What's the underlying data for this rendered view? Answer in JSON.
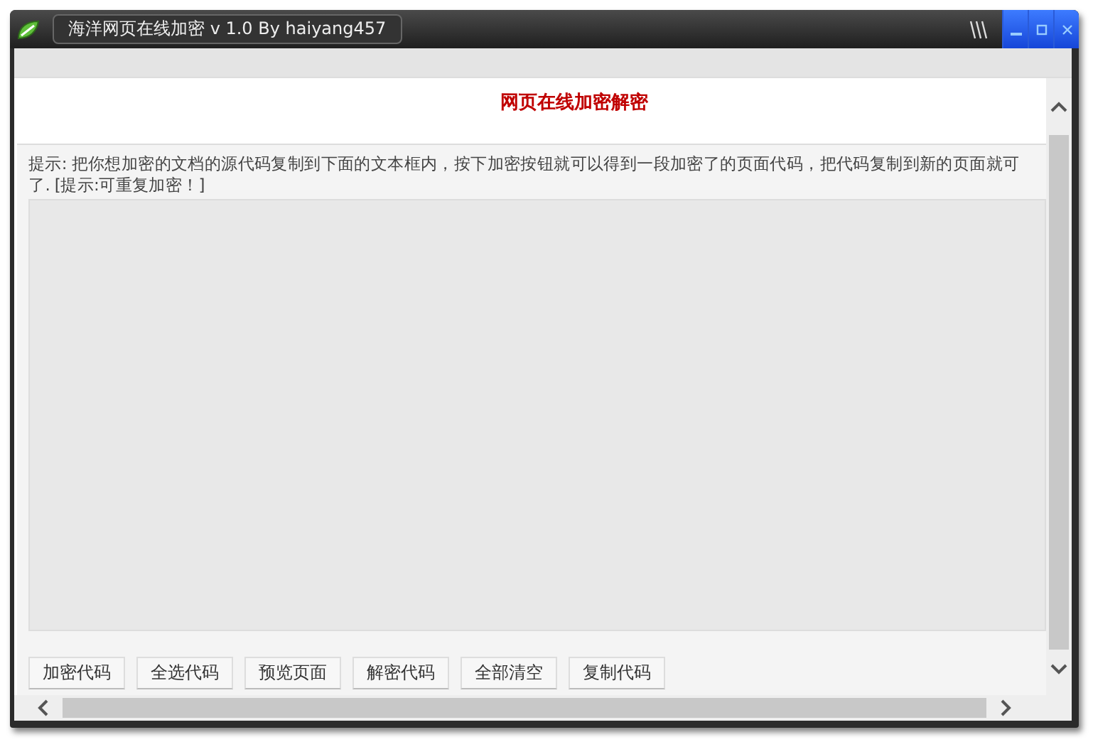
{
  "window": {
    "title": "海洋网页在线加密 v 1.0  By haiyang457"
  },
  "page": {
    "heading": "网页在线加密解密",
    "hint_lines": [
      "提示: 把你想加密的文档的源代码复制到下面的文本框内，按下加密按钮就可以得到一段加密了的页面代码，把代码复制到新的页面就可",
      "了. [提示:可重复加密！]"
    ],
    "buttons": [
      "加密代码",
      "全选代码",
      "预览页面",
      "解密代码",
      "全部清空",
      "复制代码"
    ]
  }
}
